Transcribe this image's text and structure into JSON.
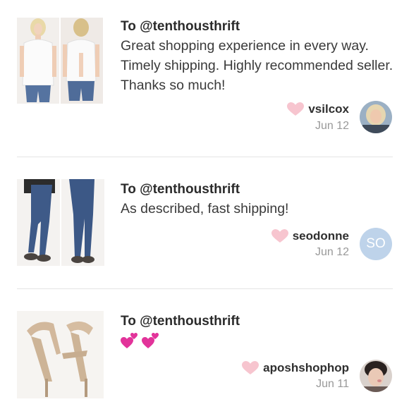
{
  "reviews": [
    {
      "to": "To @tenthousthrift",
      "text": "Great shopping experience in every way. Timely shipping. Highly recommended seller. Thanks so much!",
      "username": "vsilcox",
      "date": "Jun 12",
      "avatar_type": "photo",
      "thumbnail": "white-blouse-front-back"
    },
    {
      "to": "To @tenthousthrift",
      "text": "As described, fast shipping!",
      "username": "seodonne",
      "date": "Jun 12",
      "avatar_type": "initials",
      "avatar_initials": "SO",
      "thumbnail": "blue-skinny-jeans"
    },
    {
      "to": "To @tenthousthrift",
      "text": "",
      "emoji": "two-hearts-emoji",
      "username": "aposhshophop",
      "date": "Jun 11",
      "avatar_type": "photo",
      "thumbnail": "nude-strappy-heels"
    }
  ],
  "colors": {
    "heart": "#f7c5cf",
    "avatar_initials_bg": "#bed3ea",
    "divider": "#e4e4e4",
    "date": "#999999"
  }
}
